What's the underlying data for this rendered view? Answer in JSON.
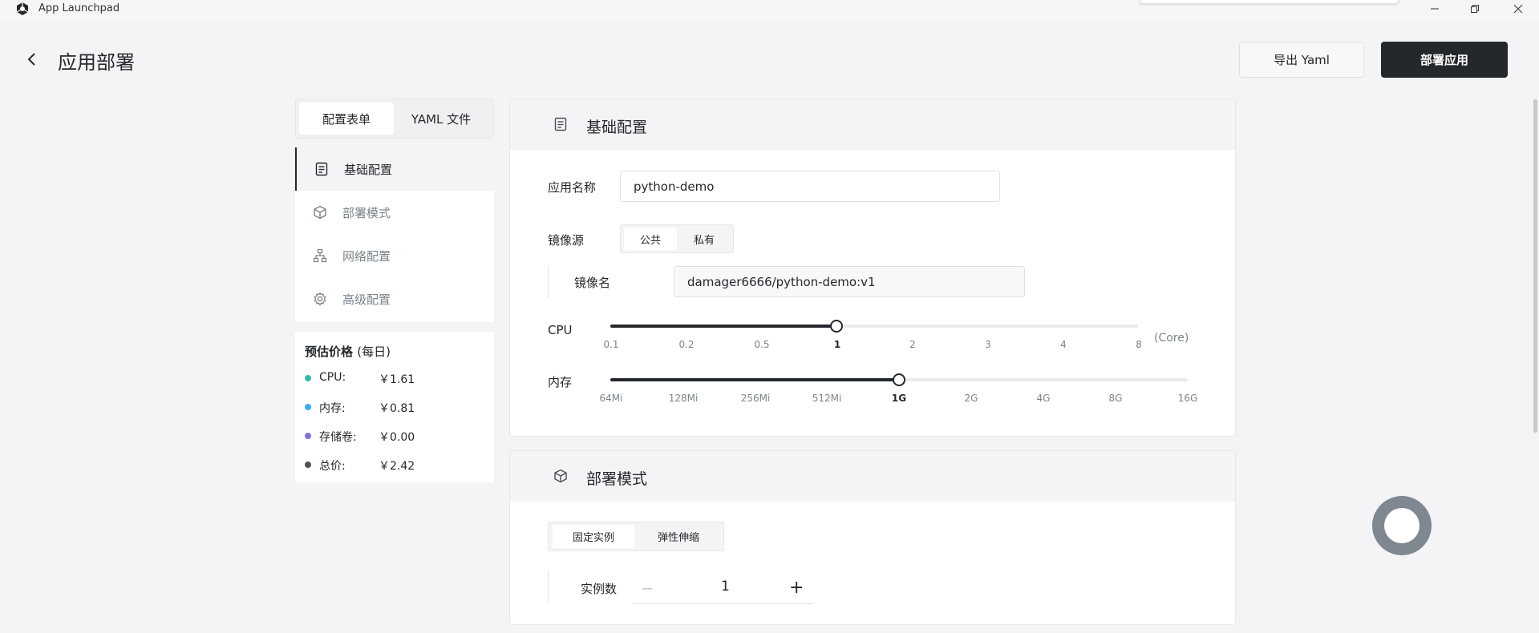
{
  "window": {
    "title": "App Launchpad"
  },
  "header": {
    "title": "应用部署",
    "export_label": "导出 Yaml",
    "deploy_label": "部署应用"
  },
  "left_tabs": [
    "配置表单",
    "YAML 文件"
  ],
  "nav": [
    {
      "label": "基础配置",
      "icon": "document-icon",
      "active": true
    },
    {
      "label": "部署模式",
      "icon": "cube-icon",
      "active": false
    },
    {
      "label": "网络配置",
      "icon": "network-icon",
      "active": false
    },
    {
      "label": "高级配置",
      "icon": "gear-icon",
      "active": false
    }
  ],
  "price": {
    "title": "预估价格",
    "subtitle": "(每日)",
    "rows": [
      {
        "name": "CPU:",
        "value": "￥1.61",
        "color": "#33bababa"
      },
      {
        "name": "内存:",
        "value": "￥0.81",
        "color": "#36adef"
      },
      {
        "name": "存储卷:",
        "value": "￥0.00",
        "color": "#8172d8"
      },
      {
        "name": "总价:",
        "value": "￥2.42",
        "color": "#485058"
      }
    ]
  },
  "basic": {
    "title": "基础配置",
    "app_name_label": "应用名称",
    "app_name_value": "python-demo",
    "image_source_label": "镜像源",
    "image_source_options": [
      "公共",
      "私有"
    ],
    "image_source_selected": "公共",
    "image_name_label": "镜像名",
    "image_name_value": "damager6666/python-demo:v1",
    "cpu": {
      "label": "CPU",
      "unit": "(Core)",
      "ticks": [
        "0.1",
        "0.2",
        "0.5",
        "1",
        "2",
        "3",
        "4",
        "8"
      ],
      "selected": "1"
    },
    "memory": {
      "label": "内存",
      "ticks": [
        "64Mi",
        "128Mi",
        "256Mi",
        "512Mi",
        "1G",
        "2G",
        "4G",
        "8G",
        "16G"
      ],
      "selected": "1G"
    }
  },
  "deploy_mode": {
    "title": "部署模式",
    "options": [
      "固定实例",
      "弹性伸缩"
    ],
    "selected": "固定实例",
    "instances_label": "实例数",
    "instances_value": "1",
    "minus": "−",
    "plus": "+"
  },
  "colors": {
    "accent": "#24282c",
    "background": "#f4f4f7"
  }
}
